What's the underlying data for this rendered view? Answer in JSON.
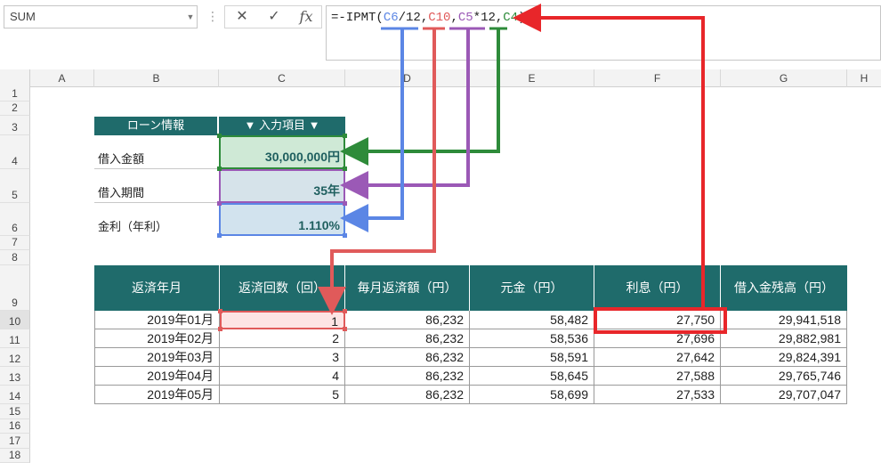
{
  "formula_bar": {
    "name_box": "SUM",
    "name_box_arrow": "▼",
    "dots": "⋮",
    "cancel_icon": "✕",
    "enter_icon": "✓",
    "fx_label": "fx",
    "formula": {
      "prefix": "=-IPMT(",
      "ref_rate": "C6",
      "rate_div": "/12,",
      "ref_per": "C10",
      "comma1": ",",
      "ref_nper": "C5",
      "nper_mult": "*12,",
      "ref_pv": "C4",
      "suffix": ")"
    }
  },
  "columns": [
    "A",
    "B",
    "C",
    "D",
    "E",
    "F",
    "G",
    "H"
  ],
  "rows": [
    "1",
    "2",
    "3",
    "4",
    "5",
    "6",
    "7",
    "8",
    "9",
    "10",
    "11",
    "12",
    "13",
    "14",
    "15",
    "16",
    "17",
    "18"
  ],
  "loan_info": {
    "header_label": "ローン情報",
    "header_value": "▼ 入力項目 ▼",
    "items": [
      {
        "label": "借入金額",
        "value": "30,000,000円"
      },
      {
        "label": "借入期間",
        "value": "35年"
      },
      {
        "label": "金利（年利）",
        "value": "1.110%"
      }
    ]
  },
  "schedule": {
    "headers": [
      "返済年月",
      "返済回数（回）",
      "毎月返済額（円）",
      "元金（円）",
      "利息（円）",
      "借入金残高（円）"
    ],
    "rows": [
      [
        "2019年01月",
        "1",
        "86,232",
        "58,482",
        "27,750",
        "29,941,518"
      ],
      [
        "2019年02月",
        "2",
        "86,232",
        "58,536",
        "27,696",
        "29,882,981"
      ],
      [
        "2019年03月",
        "3",
        "86,232",
        "58,591",
        "27,642",
        "29,824,391"
      ],
      [
        "2019年04月",
        "4",
        "86,232",
        "58,645",
        "27,588",
        "29,765,746"
      ],
      [
        "2019年05月",
        "5",
        "86,232",
        "58,699",
        "27,533",
        "29,707,047"
      ]
    ]
  },
  "colors": {
    "header_teal": "#1f6b6b",
    "ref_rate": "#5b86e5",
    "ref_per": "#e05a5a",
    "ref_nper": "#9b59b6",
    "ref_pv": "#2e8b3a",
    "highlight_red": "#e8262a"
  }
}
